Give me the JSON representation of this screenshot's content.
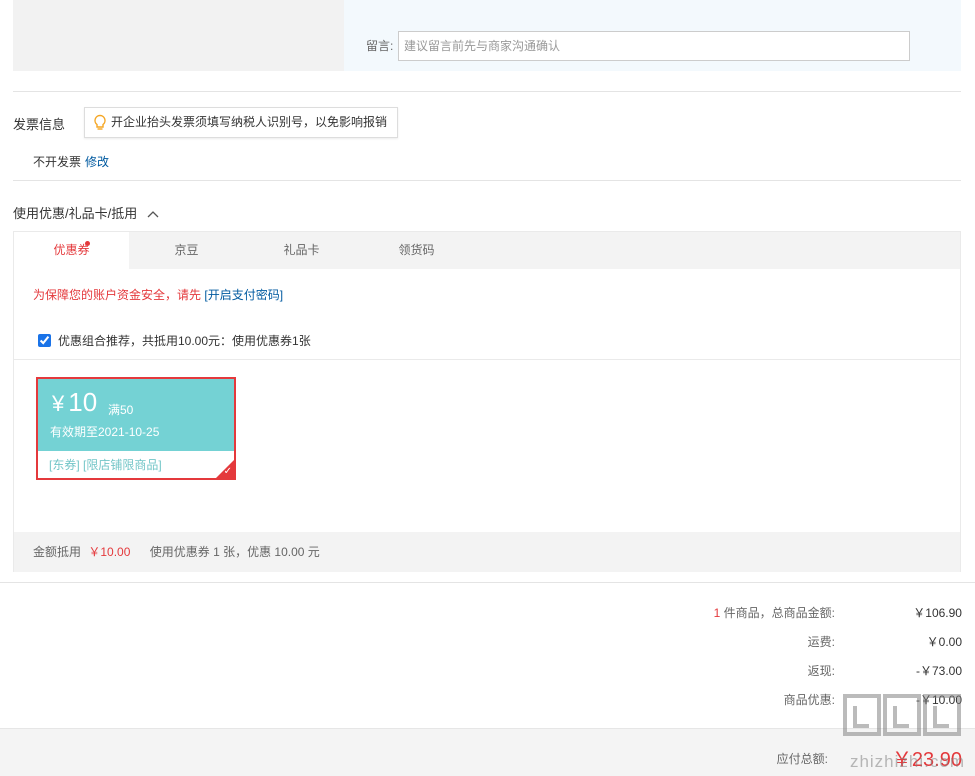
{
  "message": {
    "label": "留言:",
    "placeholder": "建议留言前先与商家沟通确认"
  },
  "invoice": {
    "title": "发票信息",
    "tip": "开企业抬头发票须填写纳税人识别号，以免影响报销",
    "status": "不开发票",
    "edit": "修改"
  },
  "coupons": {
    "heading": "使用优惠/礼品卡/抵用",
    "heading_icon": "chevron-up-icon",
    "tabs": [
      {
        "label": "优惠券",
        "active": true,
        "badge": true
      },
      {
        "label": "京豆"
      },
      {
        "label": "礼品卡"
      },
      {
        "label": "领货码"
      }
    ],
    "security_note": "为保障您的账户资金安全，请先",
    "security_link": "[开启支付密码]",
    "combo_checked": true,
    "combo_text": "优惠组合推荐，共抵用10.00元：使用优惠券1张",
    "card": {
      "currency": "¥",
      "amount": "10",
      "condition": "满50",
      "expire": "有效期至2021-10-25",
      "tags": "[东券]  [限店铺限商品]",
      "selected": true,
      "accent": "#74d2d4"
    },
    "summary_label": "金额抵用",
    "summary_amount": "￥10.00",
    "summary_used": "使用优惠券 1 张，优惠 10.00 元"
  },
  "totals": {
    "count": "1",
    "items_label": "件商品，总商品金额:",
    "items_value": "￥106.90",
    "shipping_label": "运费:",
    "shipping_value": "￥0.00",
    "cashback_label": "返现:",
    "cashback_value": "-￥73.00",
    "discount_label": "商品优惠:",
    "discount_value": "-￥10.00"
  },
  "payment": {
    "label": "应付总额:",
    "value": "￥23.90"
  },
  "watermark": "zhizhizhi.com",
  "colors": {
    "accent_red": "#e4393c",
    "link_blue": "#005aa0"
  }
}
